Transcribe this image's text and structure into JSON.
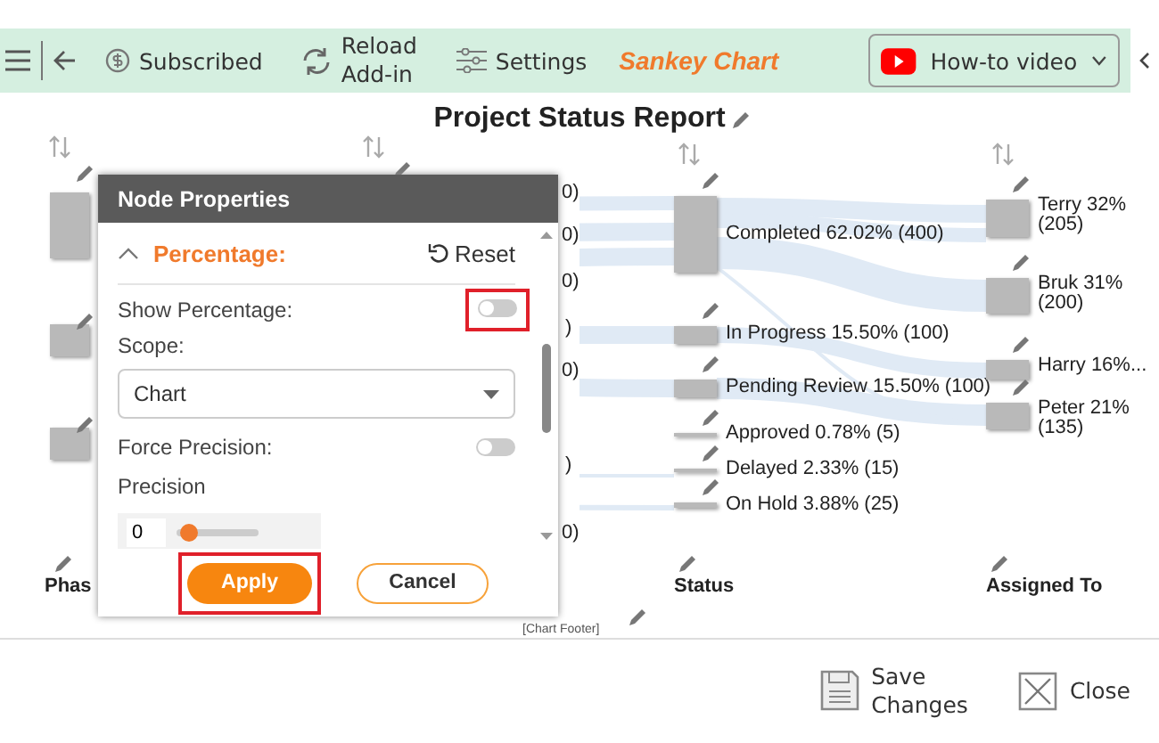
{
  "toolbar": {
    "subscribed": "Subscribed",
    "reload": "Reload Add-in",
    "settings": "Settings",
    "app_title": "Sankey Chart",
    "video_button": "How-to video"
  },
  "chart": {
    "title": "Project Status Report",
    "hidden_column_labels": [
      "0)",
      "0)",
      "0)",
      ")",
      "0)",
      ")",
      "0)"
    ],
    "status_nodes": [
      {
        "label": "Completed 62.02% (400)"
      },
      {
        "label": "In Progress 15.50% (100)"
      },
      {
        "label": "Pending Review 15.50% (100)"
      },
      {
        "label": "Approved 0.78% (5)"
      },
      {
        "label": "Delayed 2.33% (15)"
      },
      {
        "label": "On Hold 3.88% (25)"
      }
    ],
    "assignee_nodes": [
      {
        "name": "Terry 32%",
        "count": "(205)"
      },
      {
        "name": "Bruk 31%",
        "count": "(200)"
      },
      {
        "name": "Harry 16%..."
      },
      {
        "name": "Peter 21%",
        "count": "(135)"
      }
    ],
    "axis_labels": [
      "Phas",
      "Status",
      "Assigned To"
    ],
    "footer": "[Chart Footer]"
  },
  "dialog": {
    "title": "Node Properties",
    "section": "Percentage:",
    "expanded": true,
    "reset": "Reset",
    "show_percentage": {
      "label": "Show Percentage:",
      "on": false
    },
    "scope": {
      "label": "Scope:",
      "value": "Chart"
    },
    "force_precision": {
      "label": "Force Precision:",
      "on": false
    },
    "precision": {
      "label": "Precision",
      "value": "0",
      "level": 0.15
    },
    "apply": "Apply",
    "cancel": "Cancel"
  },
  "footer_bar": {
    "save": "Save Changes",
    "close": "Close"
  }
}
